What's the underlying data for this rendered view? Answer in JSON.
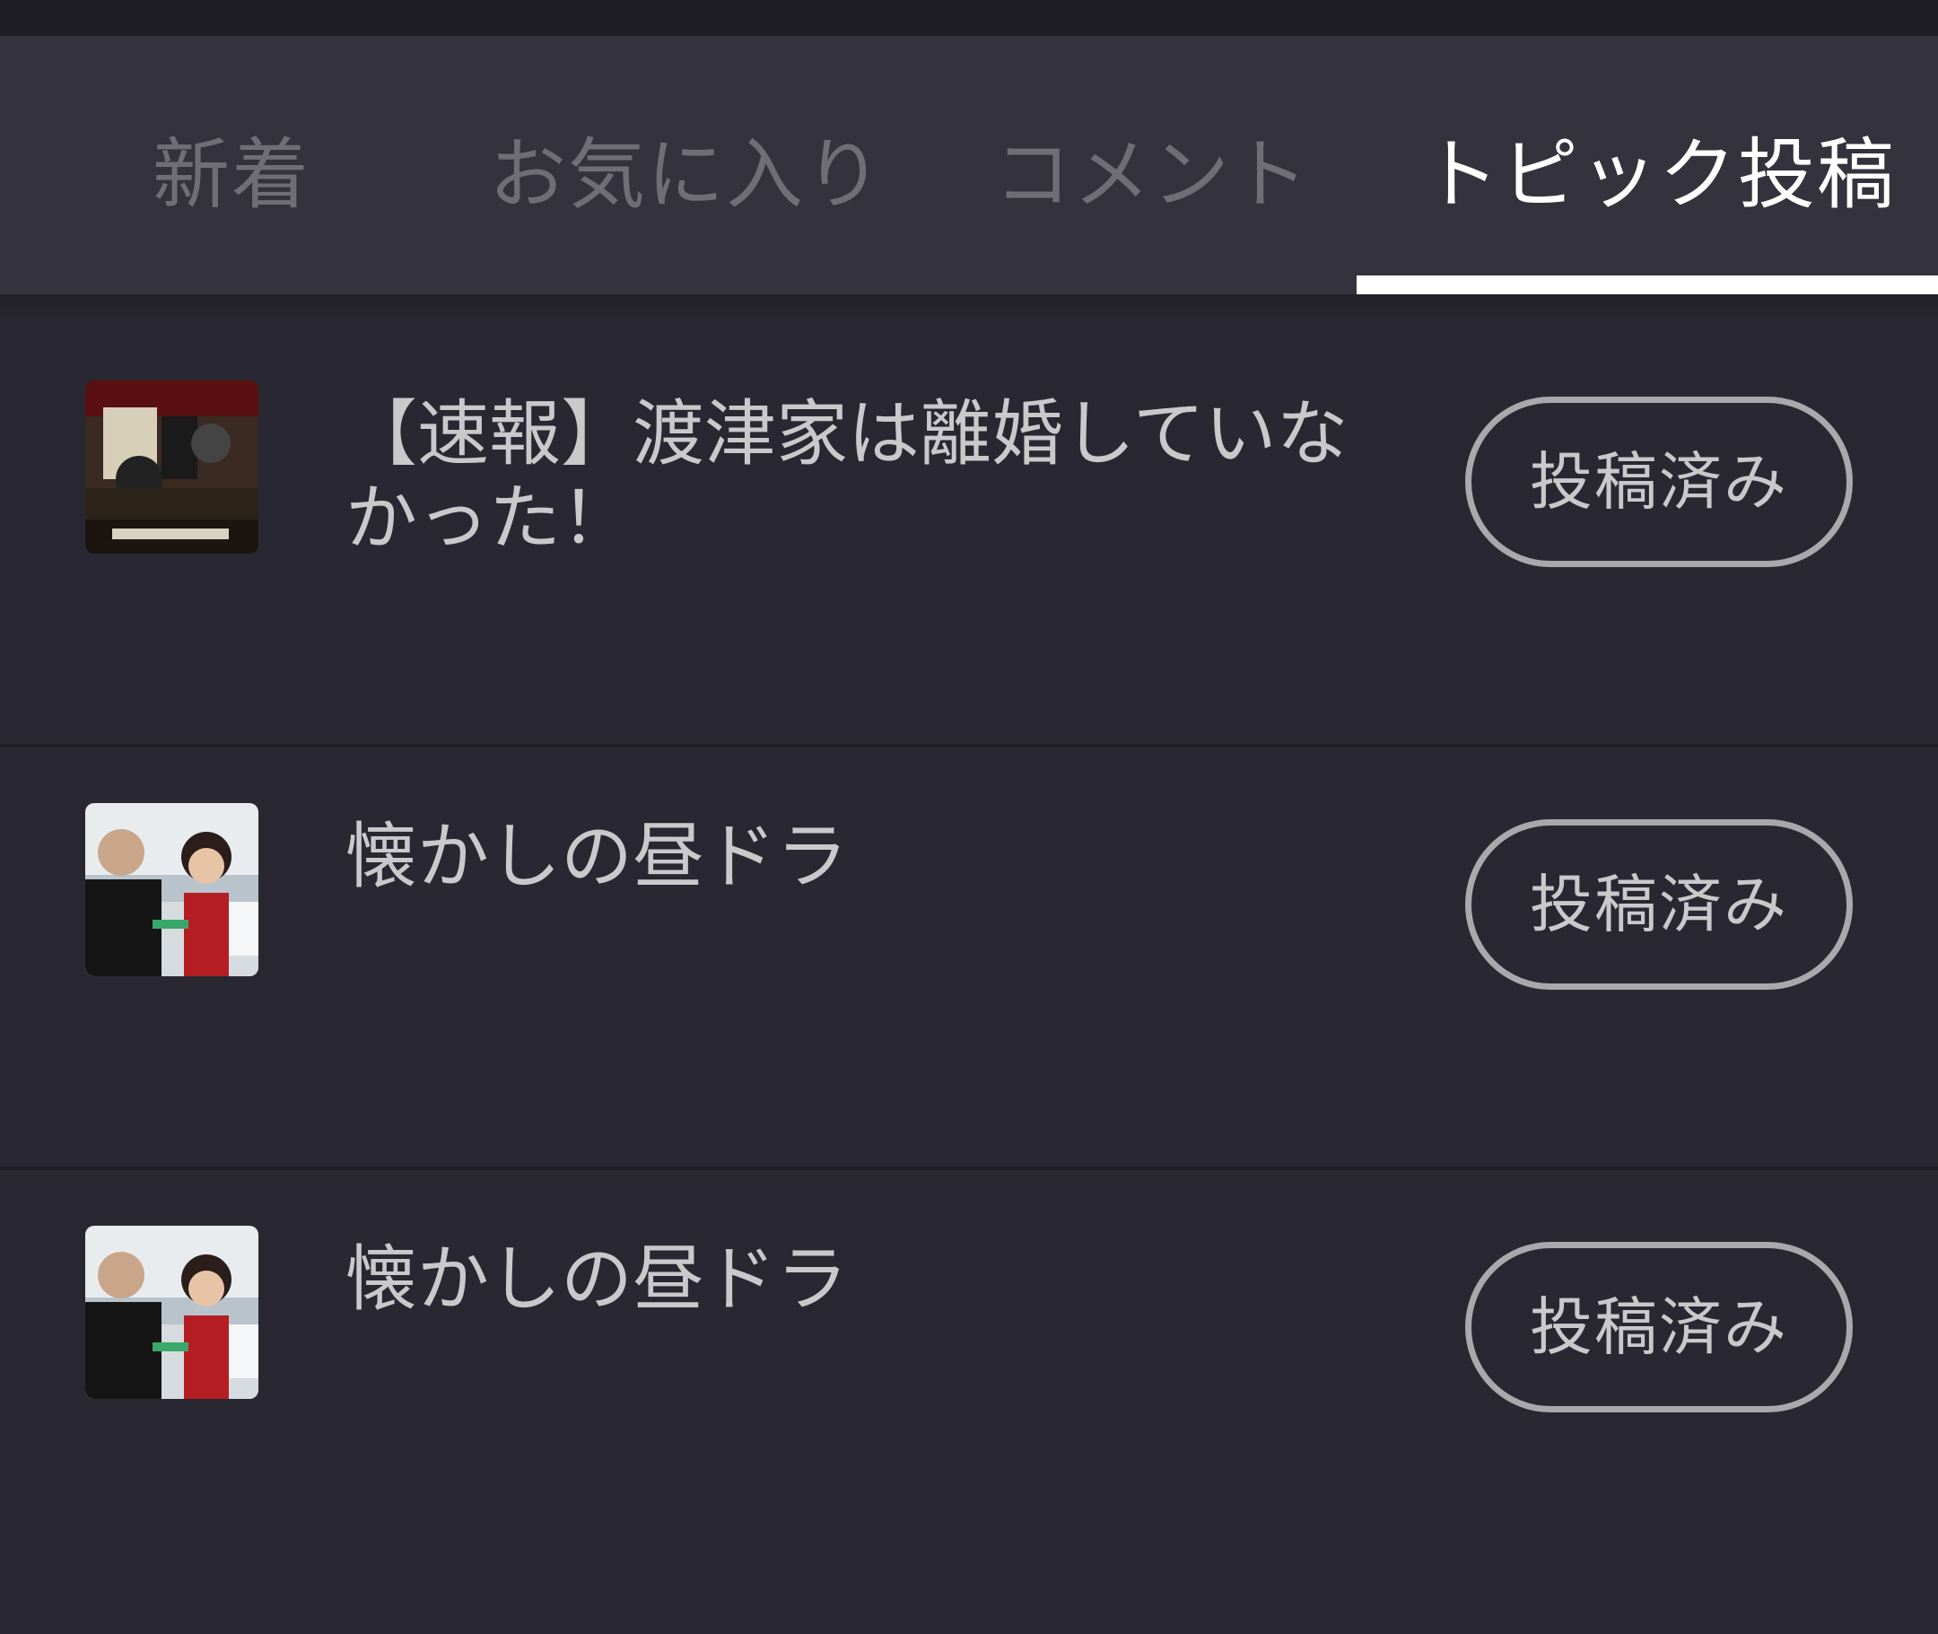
{
  "tabs": [
    {
      "label": "新着"
    },
    {
      "label": "お気に入り"
    },
    {
      "label": "コメント"
    },
    {
      "label": "トピック投稿"
    }
  ],
  "active_tab": "トピック投稿",
  "items": [
    {
      "title": "【速報】渡津家は離婚していなかった！",
      "button": "投稿済み"
    },
    {
      "title": "懐かしの昼ドラ",
      "button": "投稿済み"
    },
    {
      "title": "懐かしの昼ドラ",
      "button": "投稿済み"
    }
  ],
  "colors": {
    "background": "#292832",
    "tabbar": "#34333d",
    "active_tab_text": "#ffffff",
    "inactive_tab_text": "#6f6e76",
    "button_border": "#a9a8ad"
  }
}
